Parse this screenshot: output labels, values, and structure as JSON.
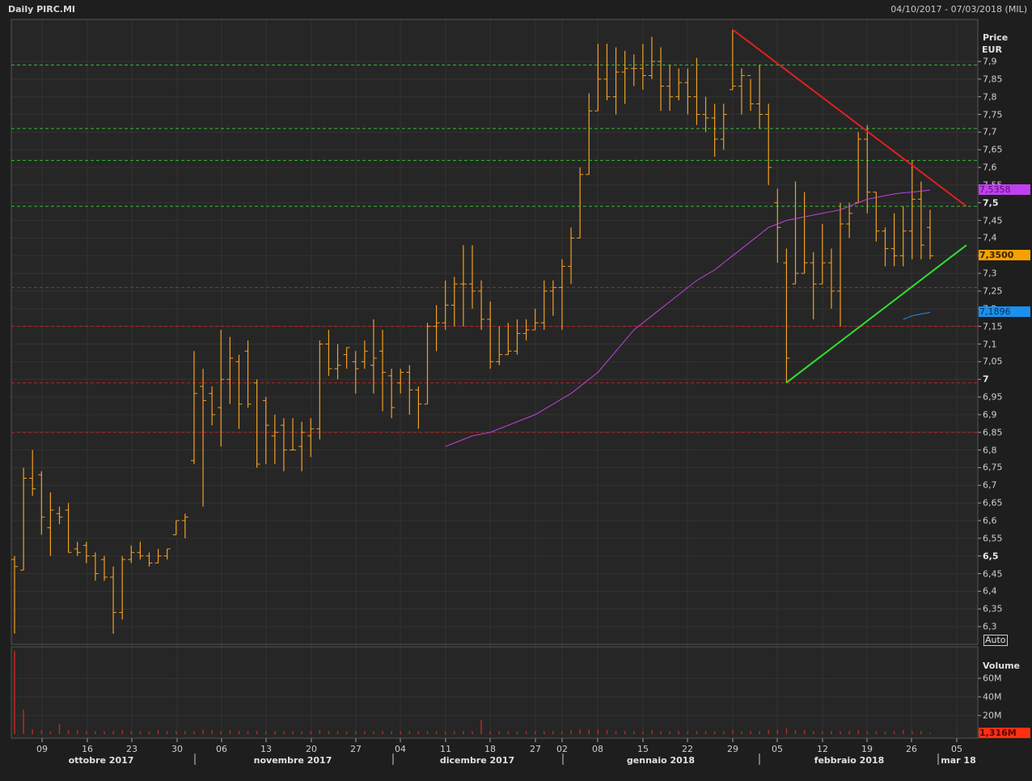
{
  "header": {
    "title": "Daily PIRC.MI",
    "range": "04/10/2017 - 07/03/2018 (MIL)"
  },
  "price_axis": {
    "title": "Price",
    "unit": "EUR",
    "auto_label": "Auto",
    "ticks": [
      "7,9",
      "7,85",
      "7,8",
      "7,75",
      "7,7",
      "7,65",
      "7,6",
      "7,55",
      "7,5",
      "7,45",
      "7,4",
      "7,35",
      "7,3",
      "7,25",
      "7,2",
      "7,15",
      "7,1",
      "7,05",
      "7",
      "6,95",
      "6,9",
      "6,85",
      "6,8",
      "6,75",
      "6,7",
      "6,65",
      "6,6",
      "6,55",
      "6,5",
      "6,45",
      "6,4",
      "6,35",
      "6,3"
    ],
    "bold_ticks": [
      "7,5",
      "7",
      "6,5"
    ]
  },
  "volume_axis": {
    "title": "Volume",
    "ticks": [
      "60M",
      "40M",
      "20M"
    ]
  },
  "tags": {
    "ma": "7,5358",
    "last": "7,3500",
    "ma2": "7,1896",
    "volume": "1,316M"
  },
  "colors": {
    "bars": "#f0a020",
    "ma": "#c040e0",
    "ma2": "#2090f0",
    "resistance": "#e02020",
    "support": "#30e030",
    "green_levels": "#30c030",
    "red_levels": "#c02020",
    "last_tag": "#f7a000",
    "ma_tag": "#c040f0",
    "ma2_tag": "#1a90f0",
    "vol_tag": "#ff3010"
  },
  "x_axis": {
    "days": [
      "09",
      "16",
      "23",
      "30",
      "06",
      "13",
      "20",
      "27",
      "04",
      "11",
      "18",
      "27",
      "02",
      "08",
      "15",
      "22",
      "29",
      "05",
      "12",
      "19",
      "26",
      "05"
    ],
    "months": [
      "ottobre 2017",
      "novembre 2017",
      "dicembre 2017",
      "gennaio 2018",
      "febbraio 2018",
      "mar 18"
    ]
  },
  "chart_data": {
    "type": "ohlc",
    "title": "Daily PIRC.MI",
    "ylim": [
      6.27,
      7.99
    ],
    "ohlc_hlc": [
      [
        6.49,
        6.5,
        6.28,
        6.47
      ],
      [
        6.46,
        6.75,
        6.46,
        6.72
      ],
      [
        6.72,
        6.8,
        6.67,
        6.69
      ],
      [
        6.73,
        6.74,
        6.56,
        6.61
      ],
      [
        6.58,
        6.68,
        6.5,
        6.63
      ],
      [
        6.62,
        6.64,
        6.59,
        6.61
      ],
      [
        6.63,
        6.65,
        6.51,
        6.51
      ],
      [
        6.52,
        6.54,
        6.5,
        6.51
      ],
      [
        6.53,
        6.54,
        6.48,
        6.5
      ],
      [
        6.5,
        6.51,
        6.43,
        6.45
      ],
      [
        6.49,
        6.5,
        6.43,
        6.44
      ],
      [
        6.44,
        6.47,
        6.28,
        6.34
      ],
      [
        6.34,
        6.5,
        6.32,
        6.49
      ],
      [
        6.49,
        6.53,
        6.48,
        6.51
      ],
      [
        6.51,
        6.54,
        6.49,
        6.5
      ],
      [
        6.5,
        6.51,
        6.47,
        6.48
      ],
      [
        6.48,
        6.52,
        6.48,
        6.5
      ],
      [
        6.5,
        6.52,
        6.49,
        6.52
      ],
      [
        6.56,
        6.6,
        6.56,
        6.6
      ],
      [
        6.6,
        6.62,
        6.55,
        6.61
      ],
      [
        6.77,
        7.08,
        6.76,
        6.96
      ],
      [
        6.98,
        7.03,
        6.64,
        6.94
      ],
      [
        6.96,
        6.98,
        6.87,
        6.9
      ],
      [
        6.92,
        7.14,
        6.81,
        7.0
      ],
      [
        7.0,
        7.12,
        6.93,
        7.06
      ],
      [
        7.05,
        7.07,
        6.86,
        6.93
      ],
      [
        7.08,
        7.11,
        6.92,
        6.93
      ],
      [
        6.99,
        7.0,
        6.75,
        6.76
      ],
      [
        6.94,
        6.95,
        6.76,
        6.87
      ],
      [
        6.84,
        6.9,
        6.76,
        6.85
      ],
      [
        6.87,
        6.89,
        6.74,
        6.8
      ],
      [
        6.8,
        6.89,
        6.8,
        6.8
      ],
      [
        6.81,
        6.88,
        6.74,
        6.85
      ],
      [
        6.84,
        6.89,
        6.78,
        6.86
      ],
      [
        6.86,
        7.11,
        6.83,
        7.1
      ],
      [
        7.1,
        7.14,
        7.01,
        7.03
      ],
      [
        7.03,
        7.1,
        7.0,
        7.04
      ],
      [
        7.07,
        7.09,
        7.03,
        7.09
      ],
      [
        7.05,
        7.08,
        6.96,
        7.03
      ],
      [
        7.05,
        7.11,
        7.03,
        7.08
      ],
      [
        7.04,
        7.17,
        6.96,
        7.06
      ],
      [
        7.08,
        7.14,
        6.91,
        7.02
      ],
      [
        7.01,
        7.03,
        6.89,
        6.92
      ],
      [
        6.99,
        7.03,
        6.96,
        7.02
      ],
      [
        7.02,
        7.04,
        6.9,
        6.97
      ],
      [
        6.97,
        6.98,
        6.86,
        6.93
      ],
      [
        6.93,
        7.16,
        6.93,
        7.15
      ],
      [
        7.15,
        7.21,
        7.08,
        7.16
      ],
      [
        7.16,
        7.28,
        7.14,
        7.21
      ],
      [
        7.21,
        7.29,
        7.15,
        7.27
      ],
      [
        7.27,
        7.38,
        7.15,
        7.27
      ],
      [
        7.27,
        7.38,
        7.2,
        7.25
      ],
      [
        7.25,
        7.28,
        7.14,
        7.17
      ],
      [
        7.17,
        7.22,
        7.03,
        7.05
      ],
      [
        7.05,
        7.15,
        7.04,
        7.07
      ],
      [
        7.07,
        7.16,
        7.07,
        7.08
      ],
      [
        7.08,
        7.17,
        7.07,
        7.13
      ],
      [
        7.13,
        7.17,
        7.11,
        7.14
      ],
      [
        7.14,
        7.2,
        7.14,
        7.16
      ],
      [
        7.16,
        7.28,
        7.14,
        7.25
      ],
      [
        7.25,
        7.28,
        7.18,
        7.26
      ],
      [
        7.26,
        7.34,
        7.14,
        7.32
      ],
      [
        7.32,
        7.43,
        7.27,
        7.4
      ],
      [
        7.4,
        7.6,
        7.4,
        7.58
      ],
      [
        7.58,
        7.81,
        7.58,
        7.76
      ],
      [
        7.76,
        7.95,
        7.76,
        7.85
      ],
      [
        7.85,
        7.95,
        7.79,
        7.8
      ],
      [
        7.8,
        7.94,
        7.75,
        7.87
      ],
      [
        7.87,
        7.93,
        7.78,
        7.88
      ],
      [
        7.88,
        7.92,
        7.83,
        7.88
      ],
      [
        7.88,
        7.95,
        7.82,
        7.86
      ],
      [
        7.86,
        7.97,
        7.85,
        7.9
      ],
      [
        7.9,
        7.94,
        7.76,
        7.83
      ],
      [
        7.83,
        7.89,
        7.76,
        7.8
      ],
      [
        7.8,
        7.88,
        7.79,
        7.84
      ],
      [
        7.84,
        7.88,
        7.75,
        7.8
      ],
      [
        7.8,
        7.91,
        7.72,
        7.75
      ],
      [
        7.75,
        7.8,
        7.7,
        7.74
      ],
      [
        7.74,
        7.78,
        7.63,
        7.68
      ],
      [
        7.68,
        7.78,
        7.65,
        7.75
      ],
      [
        7.82,
        7.99,
        7.82,
        7.83
      ],
      [
        7.83,
        7.88,
        7.75,
        7.86
      ],
      [
        7.86,
        7.85,
        7.76,
        7.78
      ],
      [
        7.78,
        7.89,
        7.71,
        7.75
      ],
      [
        7.75,
        7.78,
        7.55,
        7.6
      ],
      [
        7.5,
        7.54,
        7.33,
        7.43
      ],
      [
        7.33,
        7.37,
        6.99,
        7.06
      ],
      [
        7.27,
        7.56,
        7.27,
        7.3
      ],
      [
        7.3,
        7.53,
        7.3,
        7.33
      ],
      [
        7.33,
        7.36,
        7.17,
        7.27
      ],
      [
        7.27,
        7.44,
        7.27,
        7.33
      ],
      [
        7.33,
        7.37,
        7.2,
        7.25
      ],
      [
        7.25,
        7.5,
        7.15,
        7.44
      ],
      [
        7.44,
        7.5,
        7.4,
        7.47
      ],
      [
        7.5,
        7.7,
        7.5,
        7.68
      ],
      [
        7.68,
        7.72,
        7.47,
        7.53
      ],
      [
        7.53,
        7.53,
        7.39,
        7.42
      ],
      [
        7.42,
        7.43,
        7.32,
        7.37
      ],
      [
        7.37,
        7.47,
        7.32,
        7.35
      ],
      [
        7.35,
        7.49,
        7.32,
        7.42
      ],
      [
        7.42,
        7.62,
        7.34,
        7.51
      ],
      [
        7.51,
        7.56,
        7.34,
        7.38
      ],
      [
        7.43,
        7.48,
        7.34,
        7.35
      ]
    ],
    "ohlc_columns": [
      "open",
      "high",
      "low",
      "close"
    ],
    "moving_average": [
      6.81,
      6.82,
      6.83,
      6.84,
      6.845,
      6.85,
      6.86,
      6.87,
      6.88,
      6.89,
      6.9,
      6.915,
      6.93,
      6.945,
      6.96,
      6.98,
      7.0,
      7.02,
      7.05,
      7.08,
      7.11,
      7.14,
      7.16,
      7.18,
      7.2,
      7.22,
      7.24,
      7.26,
      7.28,
      7.295,
      7.31,
      7.33,
      7.35,
      7.37,
      7.39,
      7.41,
      7.43,
      7.44,
      7.45,
      7.455,
      7.46,
      7.465,
      7.47,
      7.475,
      7.48,
      7.49,
      7.5,
      7.51,
      7.515,
      7.52,
      7.525,
      7.528,
      7.53,
      7.533,
      7.5358
    ],
    "moving_average_2": [
      7.17,
      7.18,
      7.185,
      7.1896
    ],
    "volume_millions": [
      88,
      26,
      5,
      4,
      3,
      11,
      4,
      4,
      3,
      3,
      3,
      3,
      4,
      3,
      3,
      3,
      4,
      3,
      3,
      3,
      3,
      5,
      4,
      3,
      4,
      3,
      3,
      3,
      3,
      3,
      3,
      3,
      3,
      3,
      4,
      3,
      3,
      3,
      3,
      3,
      3,
      3,
      3,
      3,
      3,
      3,
      3,
      3,
      3,
      3,
      3,
      3,
      15,
      3,
      3,
      3,
      3,
      3,
      3,
      3,
      3,
      3,
      4,
      5,
      5,
      5,
      4,
      3,
      3,
      3,
      3,
      4,
      3,
      3,
      3,
      3,
      3,
      3,
      3,
      3,
      4,
      3,
      3,
      3,
      4,
      5,
      6,
      4,
      4,
      3,
      3,
      3,
      3,
      3,
      4,
      3,
      3,
      3,
      3,
      4,
      3,
      3,
      1.316
    ],
    "horizontal_levels_green": [
      7.89,
      7.71,
      7.62,
      7.49
    ],
    "horizontal_levels_red": [
      7.26,
      7.15,
      6.99,
      6.85
    ],
    "resistance_line": [
      7.99,
      7.49
    ],
    "support_line": [
      6.99,
      7.38
    ]
  }
}
